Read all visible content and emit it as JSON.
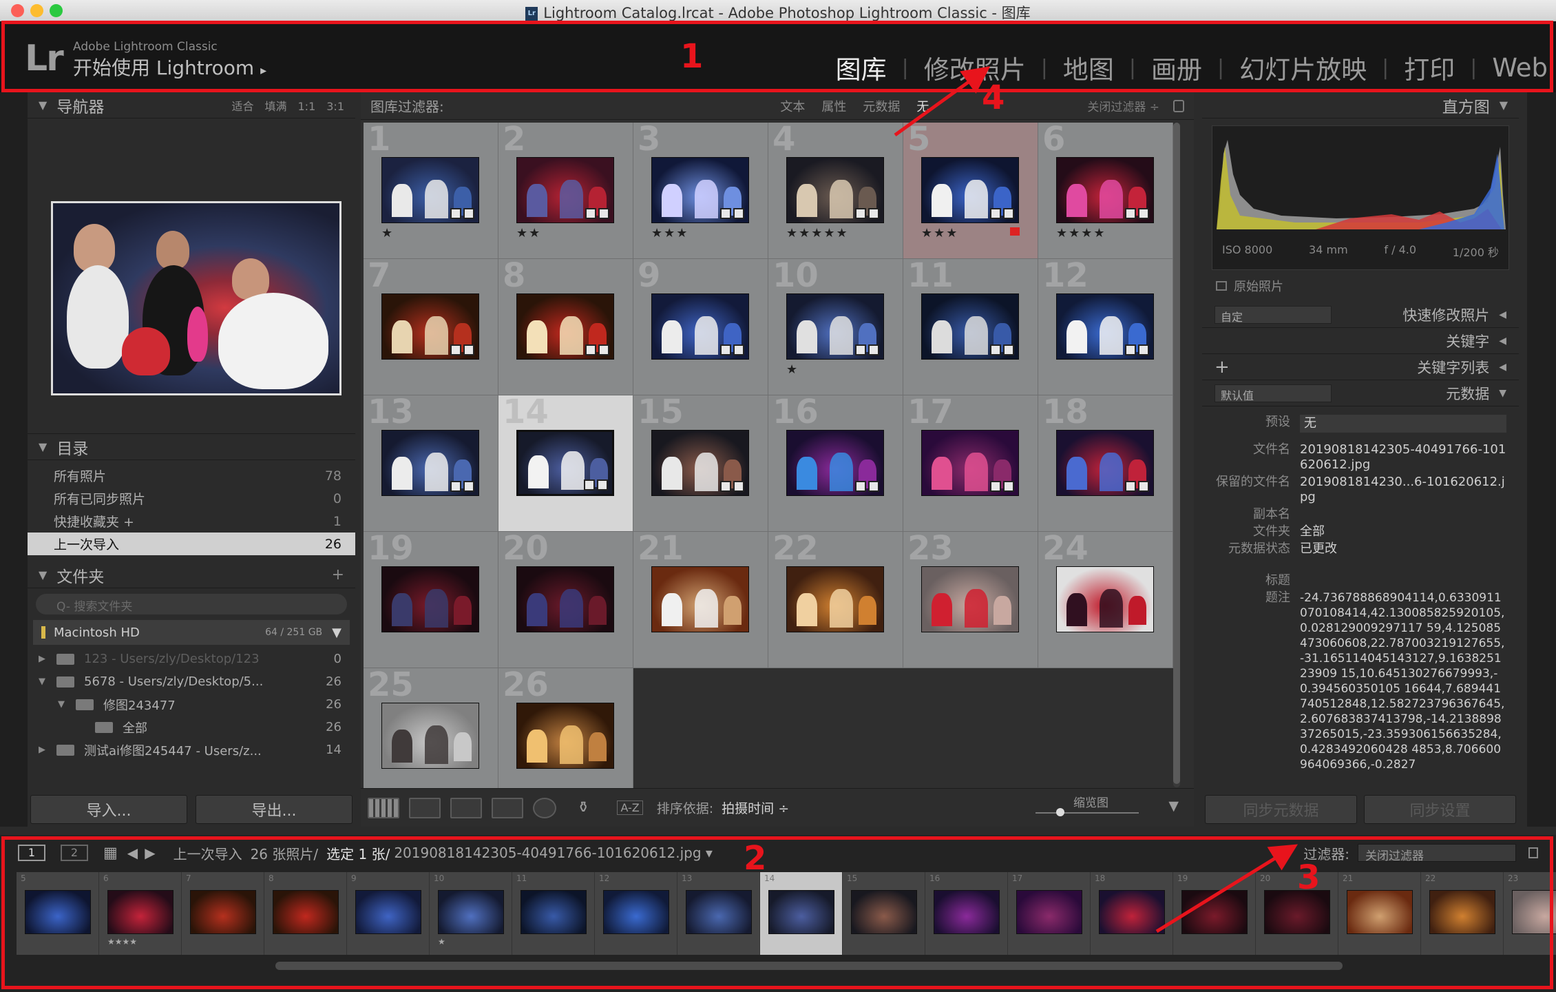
{
  "window": {
    "title": "Lightroom Catalog.lrcat - Adobe Photoshop Lightroom Classic - 图库"
  },
  "identity": {
    "logo": "Lr",
    "product": "Adobe Lightroom Classic",
    "subtitle": "开始使用 Lightroom",
    "arrow": "▸"
  },
  "modules": [
    "图库",
    "修改照片",
    "地图",
    "画册",
    "幻灯片放映",
    "打印",
    "Web"
  ],
  "callouts": [
    "1",
    "2",
    "3",
    "4"
  ],
  "navigator": {
    "title": "导航器",
    "zoom": [
      "适合",
      "填满",
      "1:1",
      "3:1"
    ]
  },
  "catalog": {
    "title": "目录",
    "rows": [
      {
        "label": "所有照片",
        "count": "78"
      },
      {
        "label": "所有已同步照片",
        "count": "0"
      },
      {
        "label": "快捷收藏夹 +",
        "count": "1"
      },
      {
        "label": "上一次导入",
        "count": "26"
      }
    ]
  },
  "folders": {
    "title": "文件夹",
    "plus": "+",
    "search_placeholder": "Q- 搜索文件夹",
    "volume": {
      "name": "Macintosh HD",
      "size": "64 / 251 GB"
    },
    "rows": [
      {
        "arrow": "▶",
        "label": "123 - Users/zly/Desktop/123",
        "count": "0",
        "dim": true
      },
      {
        "arrow": "▼",
        "label": "5678 - Users/zly/Desktop/5...",
        "count": "26",
        "dim": false
      },
      {
        "arrow": "▼",
        "label": "修图243477",
        "count": "26",
        "dim": false
      },
      {
        "arrow": "",
        "label": "全部",
        "count": "26",
        "dim": false
      },
      {
        "arrow": "▶",
        "label": "测试ai修图245447 - Users/z...",
        "count": "14",
        "dim": false
      }
    ]
  },
  "buttons": {
    "import": "导入...",
    "export": "导出...",
    "sync_meta": "同步元数据",
    "sync_settings": "同步设置"
  },
  "filterbar": {
    "label": "图库过滤器:",
    "options": [
      "文本",
      "属性",
      "元数据",
      "无"
    ],
    "active": "无",
    "close": "关闭过滤器 ÷"
  },
  "grid": [
    {
      "n": "1",
      "stars": "★",
      "flag": false
    },
    {
      "n": "2",
      "stars": "★★",
      "flag": false
    },
    {
      "n": "3",
      "stars": "★★★",
      "flag": false
    },
    {
      "n": "4",
      "stars": "★★★★★",
      "flag": false
    },
    {
      "n": "5",
      "stars": "★★★",
      "flag": true
    },
    {
      "n": "6",
      "stars": "★★★★",
      "flag": false
    },
    {
      "n": "7",
      "stars": "",
      "flag": false
    },
    {
      "n": "8",
      "stars": "",
      "flag": false
    },
    {
      "n": "9",
      "stars": "",
      "flag": false
    },
    {
      "n": "10",
      "stars": "★",
      "flag": false
    },
    {
      "n": "11",
      "stars": "",
      "flag": false
    },
    {
      "n": "12",
      "stars": "",
      "flag": false
    },
    {
      "n": "13",
      "stars": "",
      "flag": false
    },
    {
      "n": "14",
      "stars": "",
      "flag": false,
      "selected": true
    },
    {
      "n": "15",
      "stars": "",
      "flag": false
    },
    {
      "n": "16",
      "stars": "",
      "flag": false
    },
    {
      "n": "17",
      "stars": "",
      "flag": false
    },
    {
      "n": "18",
      "stars": "",
      "flag": false
    },
    {
      "n": "19",
      "stars": "",
      "flag": false
    },
    {
      "n": "20",
      "stars": "",
      "flag": false
    },
    {
      "n": "21",
      "stars": "",
      "flag": false
    },
    {
      "n": "22",
      "stars": "",
      "flag": false
    },
    {
      "n": "23",
      "stars": "",
      "flag": false
    },
    {
      "n": "24",
      "stars": "",
      "flag": false
    },
    {
      "n": "25",
      "stars": "",
      "flag": false
    },
    {
      "n": "26",
      "stars": "",
      "flag": false
    }
  ],
  "toolbar": {
    "sort_label": "排序依据:",
    "sort_value": "拍摄时间 ÷",
    "thumbs_label": "缩览图",
    "az": "A-Z"
  },
  "histogram": {
    "title": "直方图",
    "iso": "ISO 8000",
    "focal": "34 mm",
    "aperture": "f / 4.0",
    "shutter": "1/200 秒",
    "original": "原始照片"
  },
  "right": {
    "quick_preset": "自定",
    "quick_label": "快速修改照片",
    "keywords": "关键字",
    "keyword_list": "关键字列表",
    "meta_preset": "默认值",
    "meta_label": "元数据",
    "preset_key": "预设",
    "preset_val": "无",
    "fields": [
      {
        "k": "文件名",
        "v": "20190818142305-40491766-101620612.jpg"
      },
      {
        "k": "保留的文件名",
        "v": "2019081814230...6-101620612.jpg"
      },
      {
        "k": "副本名",
        "v": ""
      },
      {
        "k": "文件夹",
        "v": "全部"
      },
      {
        "k": "元数据状态",
        "v": "已更改"
      },
      {
        "k": "标题",
        "v": ""
      },
      {
        "k": "题注",
        "v": "-24.736788868904114,0.6330911070108414,42.130085825920105,0.028129009297117 59,4.125085473060608,22.787003219127655,-31.165114045143127,9.163825123909 15,10.645130276679993,-0.394560350105 16644,7.689441740512848,12.582723796367645,2.607683837413798,-14.213889837265015,-23.359306156635284,0.4283492060428 4853,8.706600964069366,-0.2827"
      }
    ]
  },
  "filmstrip": {
    "mon1": "1",
    "mon2": "2",
    "source": "上一次导入",
    "count": "26 张照片/",
    "selected": "选定 1 张/",
    "file": "20190818142305-40491766-101620612.jpg ▾",
    "filter_label": "过滤器:",
    "filter_value": "关闭过滤器",
    "cells": [
      {
        "n": "5",
        "s": ""
      },
      {
        "n": "6",
        "s": "★★★★"
      },
      {
        "n": "7",
        "s": ""
      },
      {
        "n": "8",
        "s": ""
      },
      {
        "n": "9",
        "s": ""
      },
      {
        "n": "10",
        "s": "★"
      },
      {
        "n": "11",
        "s": ""
      },
      {
        "n": "12",
        "s": ""
      },
      {
        "n": "13",
        "s": ""
      },
      {
        "n": "14",
        "s": "",
        "sel": true
      },
      {
        "n": "15",
        "s": ""
      },
      {
        "n": "16",
        "s": ""
      },
      {
        "n": "17",
        "s": ""
      },
      {
        "n": "18",
        "s": ""
      },
      {
        "n": "19",
        "s": ""
      },
      {
        "n": "20",
        "s": ""
      },
      {
        "n": "21",
        "s": ""
      },
      {
        "n": "22",
        "s": ""
      },
      {
        "n": "23",
        "s": ""
      }
    ]
  },
  "colors": {
    "annotation": "#e8141c",
    "selection": "#d6d6d6"
  }
}
